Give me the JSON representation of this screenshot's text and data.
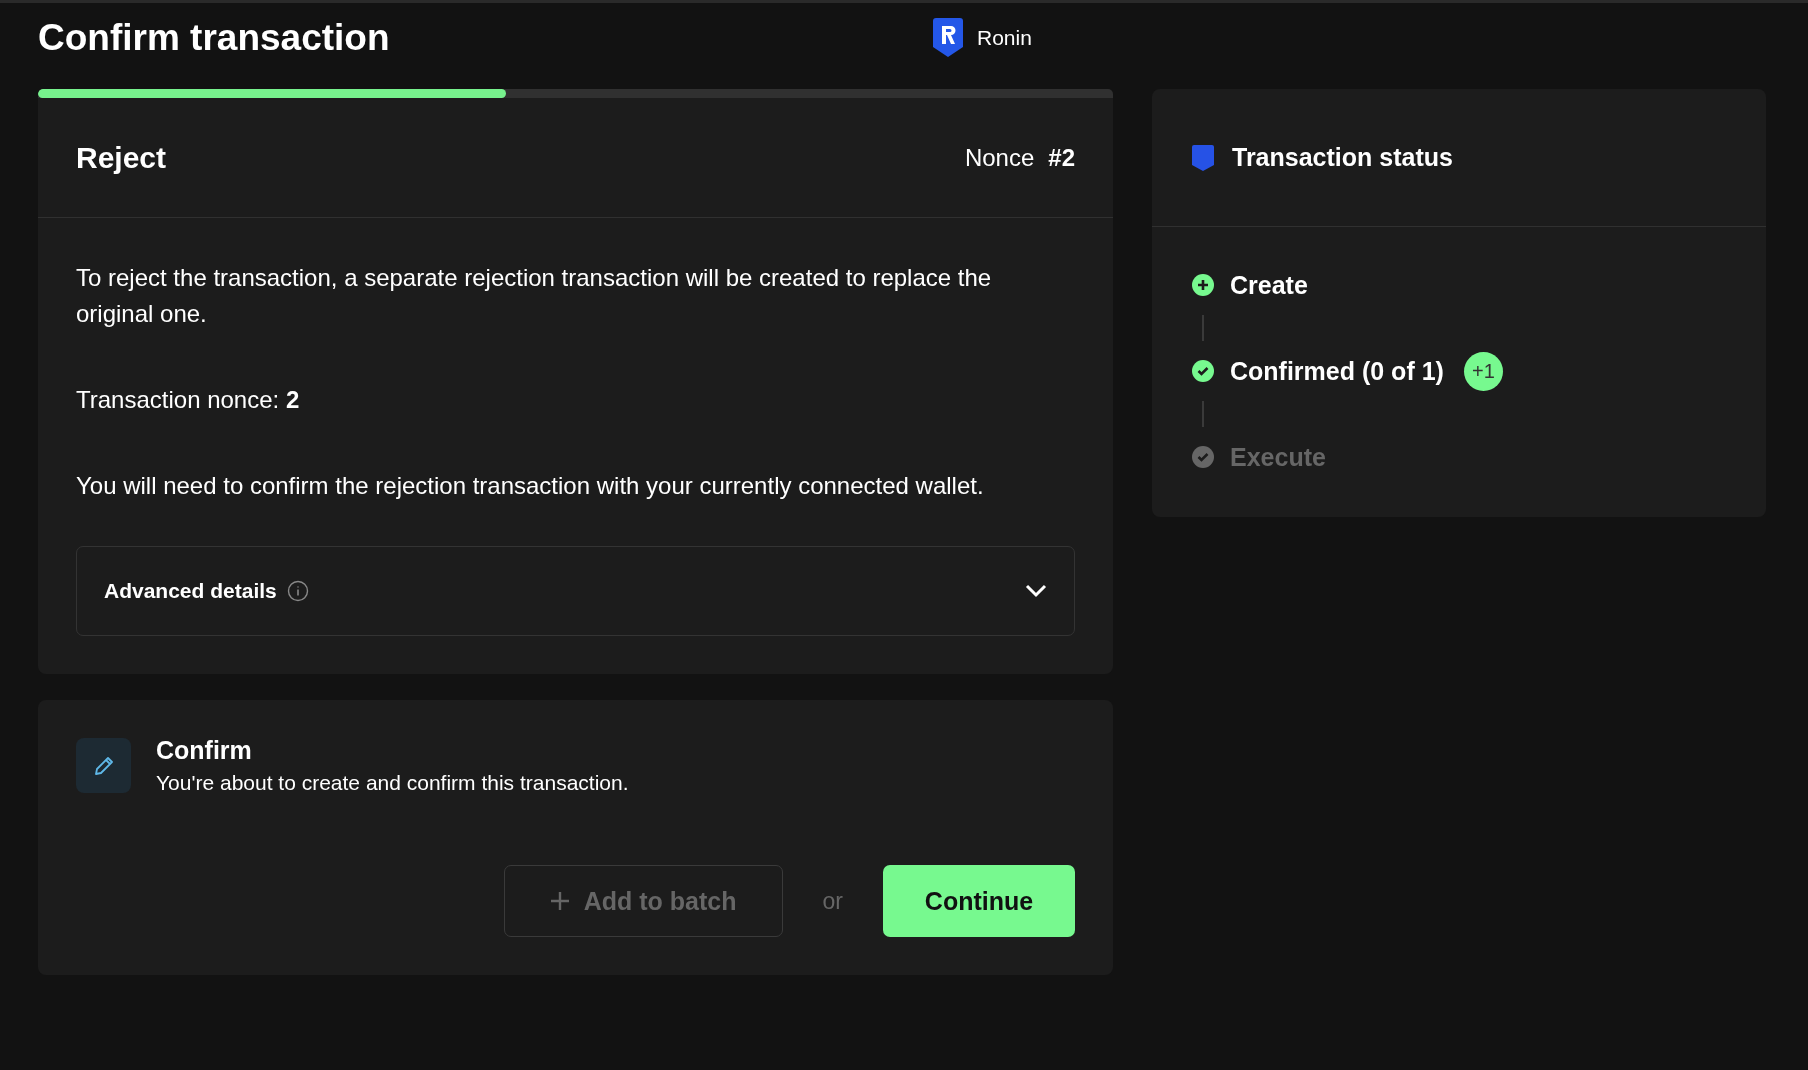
{
  "header": {
    "title": "Confirm transaction",
    "network": "Ronin"
  },
  "progress": {
    "level": 0.435
  },
  "reject_card": {
    "title": "Reject",
    "nonce_label": "Nonce",
    "nonce_value": "#2",
    "paragraphs": [
      "To reject the transaction, a separate rejection transaction will be created to replace the original one.",
      "Transaction nonce: **2**",
      "You will need to confirm the rejection transaction with your currently connected wallet."
    ],
    "advanced": {
      "label": "Advanced details",
      "expanded": false
    }
  },
  "confirm_card": {
    "title": "Confirm",
    "description": "You're about to create and confirm this transaction.",
    "batch_button": {
      "label": "Add to batch",
      "disabled": true
    },
    "separator": "or",
    "continue_button": "Continue"
  },
  "status_panel": {
    "title": "Transaction status",
    "steps": [
      {
        "kind": "create",
        "label": "Create",
        "done": true
      },
      {
        "kind": "confirm",
        "label": "Confirmed (0 of 1)",
        "done": true,
        "badge": "+1"
      },
      {
        "kind": "execute",
        "label": "Execute",
        "done": false
      }
    ]
  }
}
